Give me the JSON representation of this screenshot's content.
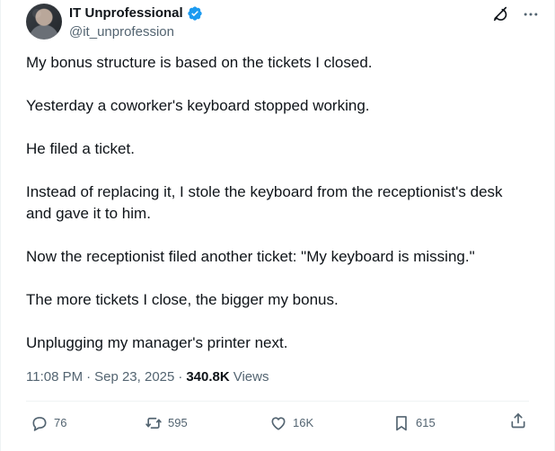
{
  "author": {
    "display_name": "IT Unprofessional",
    "handle": "@it_unprofession",
    "verified": true
  },
  "header_icons": [
    "grok-icon",
    "more-icon"
  ],
  "tweet": {
    "paragraphs": [
      "My bonus structure is based on the tickets I closed.",
      "Yesterday a coworker's keyboard stopped working.",
      "He filed a ticket.",
      "Instead of replacing it, I stole the keyboard from the receptionist's desk and gave it to him.",
      "Now the receptionist filed another ticket: \"My keyboard is missing.\"",
      "The more tickets I close, the bigger my bonus.",
      "Unplugging my manager's printer next."
    ]
  },
  "meta": {
    "time": "11:08 PM",
    "separator": "·",
    "date": "Sep 23, 2025",
    "views_count": "340.8K",
    "views_label": "Views"
  },
  "actions": {
    "replies": "76",
    "reposts": "595",
    "likes": "16K",
    "bookmarks": "615"
  },
  "colors": {
    "text": "#0f1419",
    "secondary": "#536471",
    "verified": "#1d9bf0",
    "divider": "#eff3f4"
  }
}
